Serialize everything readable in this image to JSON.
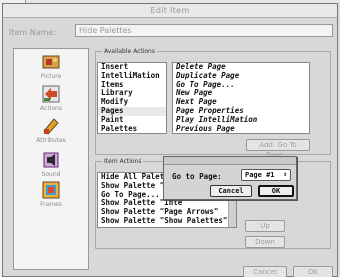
{
  "dialog": {
    "title": "Edit Item"
  },
  "item_name": {
    "label": "Item Name:",
    "value": "Hide Palettes"
  },
  "categories": [
    {
      "label": "Picture",
      "icon": "picture-icon"
    },
    {
      "label": "Actions",
      "icon": "actions-icon"
    },
    {
      "label": "Attributes",
      "icon": "attributes-icon"
    },
    {
      "label": "Sound",
      "icon": "sound-icon"
    },
    {
      "label": "Frames",
      "icon": "frames-icon"
    }
  ],
  "available_actions": {
    "label": "Available Actions",
    "categories": [
      "Insert",
      "IntelliMation",
      "Items",
      "Library",
      "Modify",
      "Pages",
      "Paint",
      "Palettes"
    ],
    "selected_category": "Pages",
    "actions": [
      "Delete Page",
      "Duplicate Page",
      "Go To Page...",
      "New Page",
      "Next Page",
      "Page Properties",
      "Play IntelliMation",
      "Previous Page"
    ],
    "add_button": "Add:  Go To Page..."
  },
  "item_actions": {
    "label": "Item Actions",
    "rows": [
      "Hide All Palettes",
      "Show Palette \"Colo",
      "Go To Page...",
      "Show Palette \"Inte",
      "Show Palette \"Page Arrows\"",
      "Show Palette \"Show Palettes\""
    ],
    "up_button": "Up",
    "down_button": "Down"
  },
  "goto_popup": {
    "label": "Go to Page:",
    "selected": "Page #1",
    "cancel": "Cancel",
    "ok": "OK"
  },
  "footer": {
    "cancel": "Cancel",
    "ok": "OK"
  }
}
